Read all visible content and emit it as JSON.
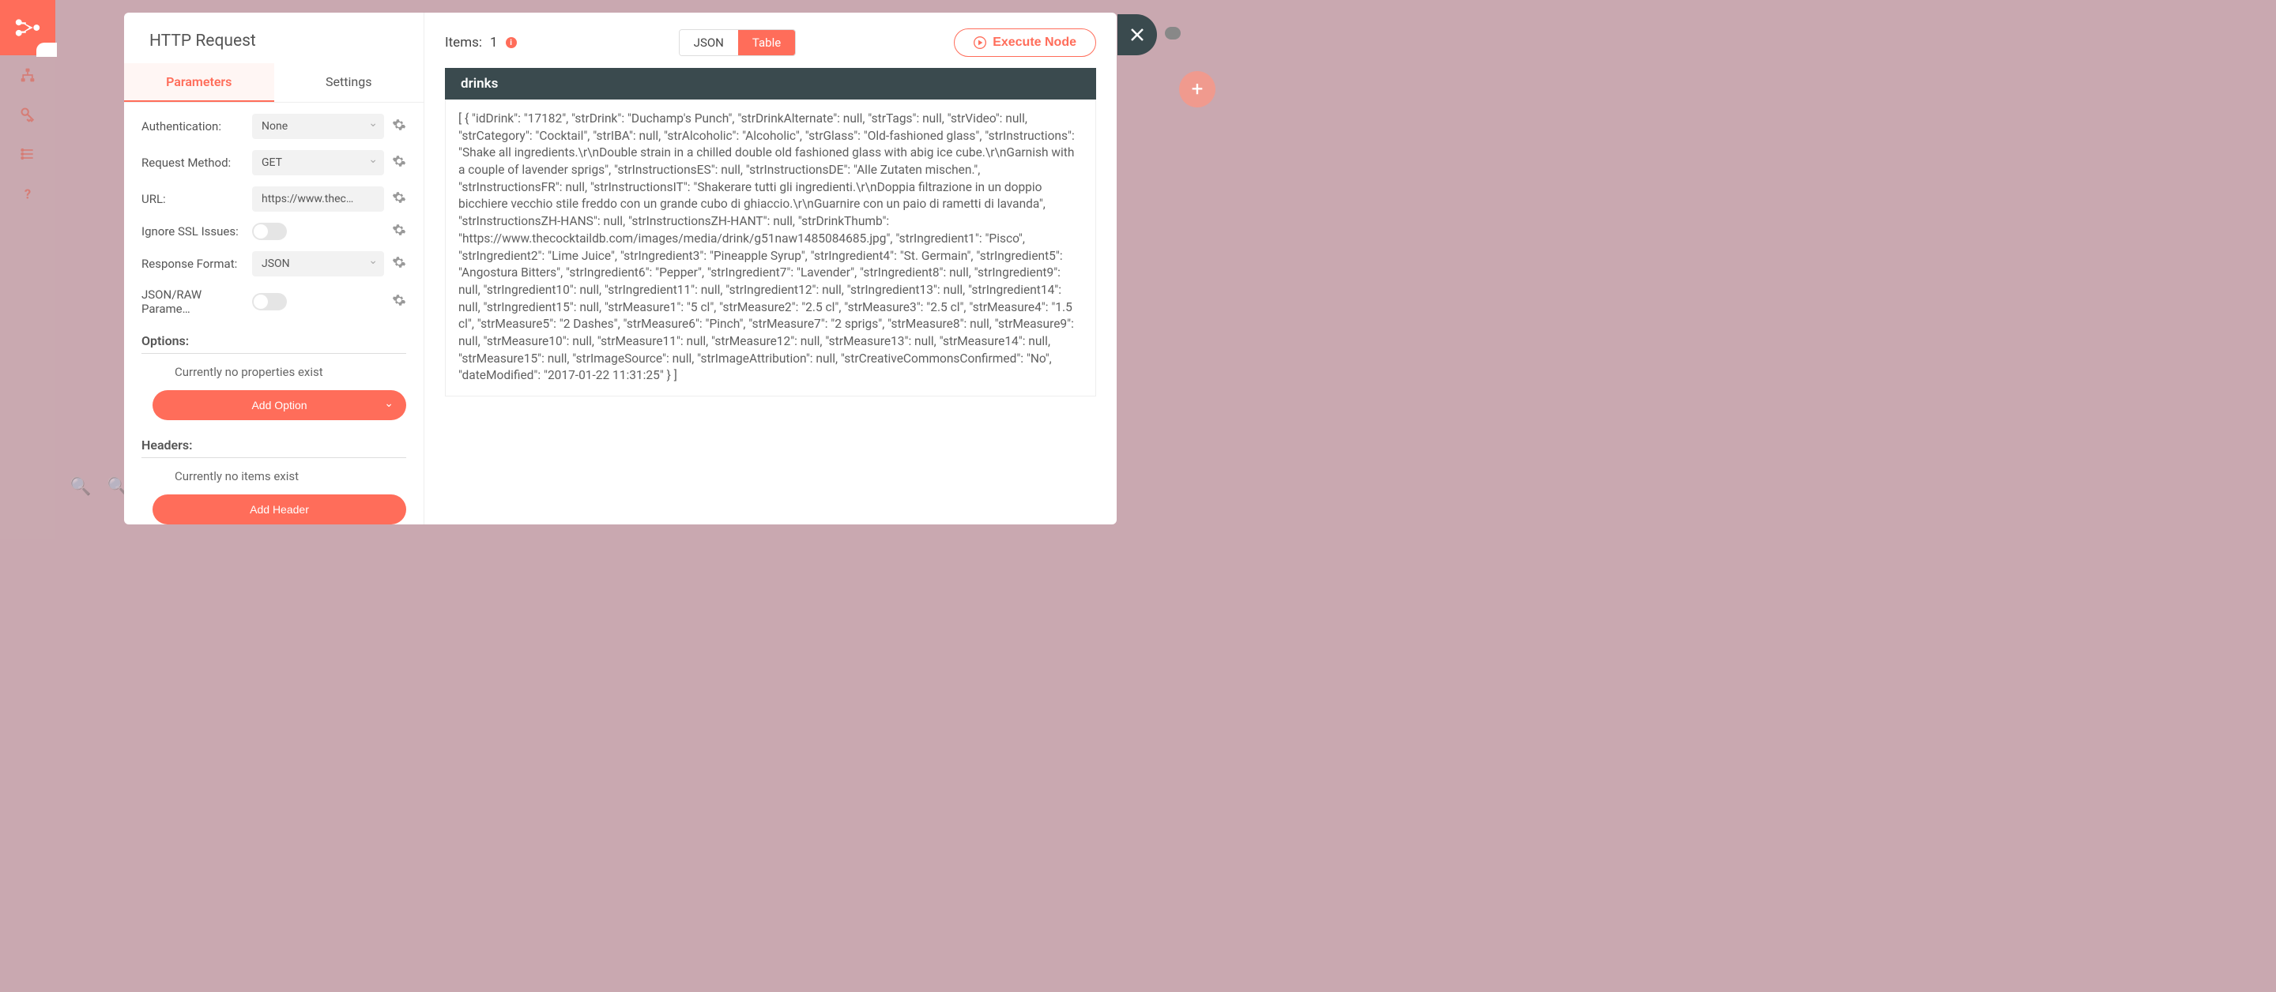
{
  "modal": {
    "title": "HTTP Request",
    "tabs": {
      "params": "Parameters",
      "settings": "Settings"
    }
  },
  "params": {
    "auth": {
      "label": "Authentication:",
      "value": "None"
    },
    "method": {
      "label": "Request Method:",
      "value": "GET"
    },
    "url": {
      "label": "URL:",
      "value": "https://www.thec…"
    },
    "ssl": {
      "label": "Ignore SSL Issues:"
    },
    "format": {
      "label": "Response Format:",
      "value": "JSON"
    },
    "raw": {
      "label": "JSON/RAW Parame…"
    }
  },
  "options": {
    "title": "Options:",
    "empty": "Currently no properties exist",
    "button": "Add Option"
  },
  "headers": {
    "title": "Headers:",
    "empty": "Currently no items exist",
    "button": "Add Header"
  },
  "results": {
    "items_label": "Items:",
    "items_count": "1",
    "view_json": "JSON",
    "view_table": "Table",
    "execute": "Execute Node",
    "column": "drinks",
    "cell": "[ { \"idDrink\": \"17182\", \"strDrink\": \"Duchamp's Punch\", \"strDrinkAlternate\": null, \"strTags\": null, \"strVideo\": null, \"strCategory\": \"Cocktail\", \"strIBA\": null, \"strAlcoholic\": \"Alcoholic\", \"strGlass\": \"Old-fashioned glass\", \"strInstructions\": \"Shake all ingredients.\\r\\nDouble strain in a chilled double old fashioned glass with abig ice cube.\\r\\nGarnish with a couple of lavender sprigs\", \"strInstructionsES\": null, \"strInstructionsDE\": \"Alle Zutaten mischen.\", \"strInstructionsFR\": null, \"strInstructionsIT\": \"Shakerare tutti gli ingredienti.\\r\\nDoppia filtrazione in un doppio bicchiere vecchio stile freddo con un grande cubo di ghiaccio.\\r\\nGuarnire con un paio di rametti di lavanda\", \"strInstructionsZH-HANS\": null, \"strInstructionsZH-HANT\": null, \"strDrinkThumb\": \"https://www.thecocktaildb.com/images/media/drink/g51naw1485084685.jpg\", \"strIngredient1\": \"Pisco\", \"strIngredient2\": \"Lime Juice\", \"strIngredient3\": \"Pineapple Syrup\", \"strIngredient4\": \"St. Germain\", \"strIngredient5\": \"Angostura Bitters\", \"strIngredient6\": \"Pepper\", \"strIngredient7\": \"Lavender\", \"strIngredient8\": null, \"strIngredient9\": null, \"strIngredient10\": null, \"strIngredient11\": null, \"strIngredient12\": null, \"strIngredient13\": null, \"strIngredient14\": null, \"strIngredient15\": null, \"strMeasure1\": \"5 cl\", \"strMeasure2\": \"2.5 cl\", \"strMeasure3\": \"2.5 cl\", \"strMeasure4\": \"1.5 cl\", \"strMeasure5\": \"2 Dashes\", \"strMeasure6\": \"Pinch\", \"strMeasure7\": \"2 sprigs\", \"strMeasure8\": null, \"strMeasure9\": null, \"strMeasure10\": null, \"strMeasure11\": null, \"strMeasure12\": null, \"strMeasure13\": null, \"strMeasure14\": null, \"strMeasure15\": null, \"strImageSource\": null, \"strImageAttribution\": null, \"strCreativeCommonsConfirmed\": \"No\", \"dateModified\": \"2017-01-22 11:31:25\" } ]"
  }
}
